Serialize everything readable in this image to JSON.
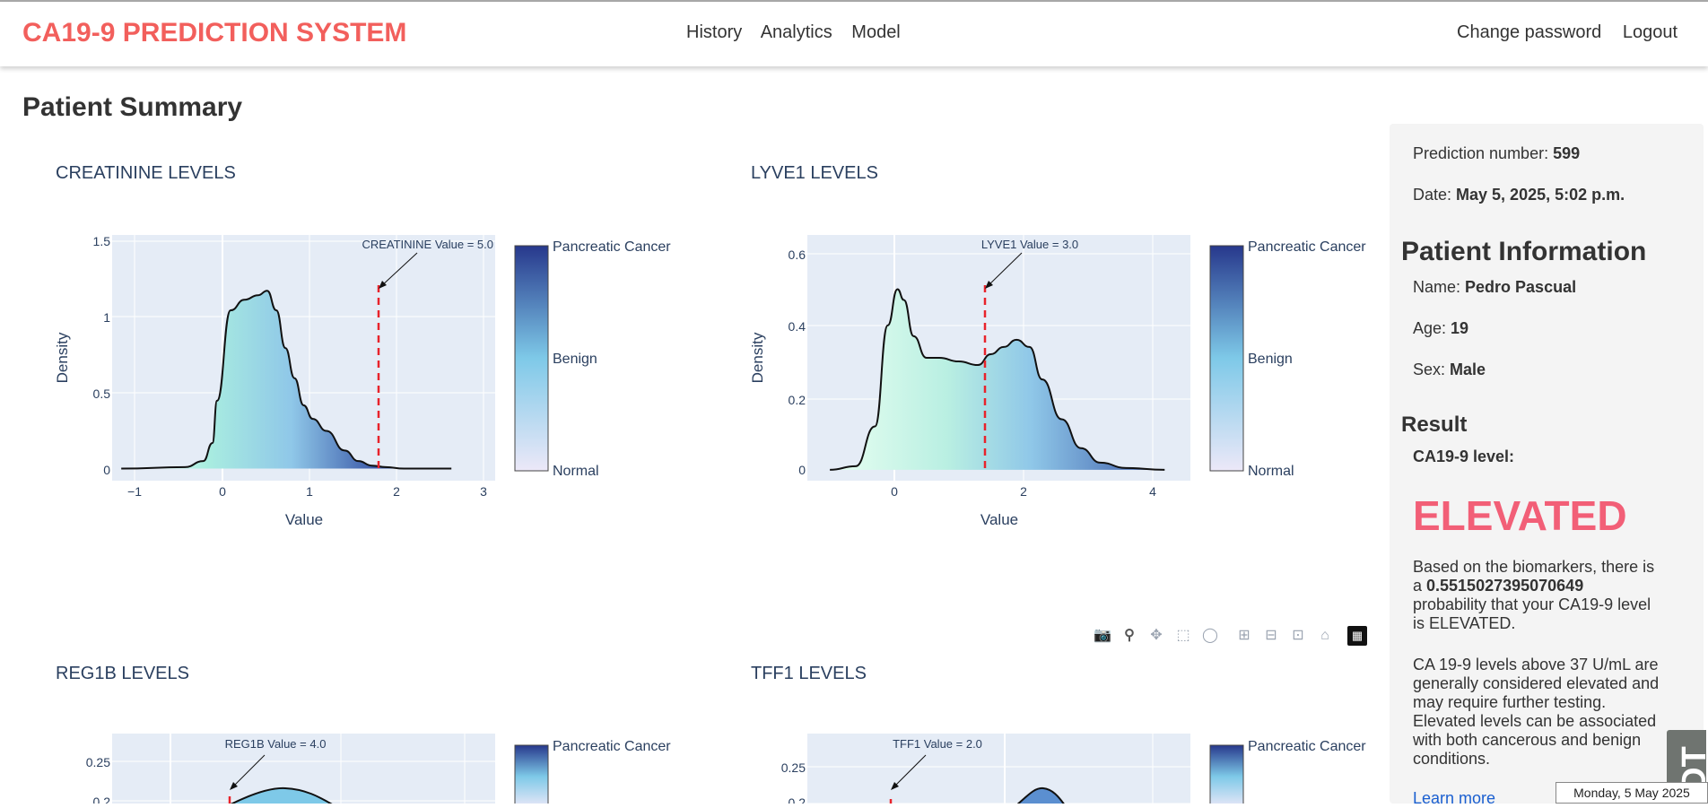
{
  "navbar": {
    "brand": "CA19-9 PREDICTION SYSTEM",
    "links": [
      "History",
      "Analytics",
      "Model"
    ],
    "right_links": [
      "Change password",
      "Logout"
    ]
  },
  "page_title": "Patient Summary",
  "plots": [
    {
      "title": "CREATININE LEVELS",
      "annotation": "CREATININE Value = 5.0",
      "ylabel": "Density",
      "xlabel": "Value",
      "xticks": [
        "−1",
        "0",
        "1",
        "2",
        "3"
      ],
      "yticks": [
        "0",
        "0.5",
        "1",
        "1.5"
      ]
    },
    {
      "title": "LYVE1 LEVELS",
      "annotation": "LYVE1 Value = 3.0",
      "ylabel": "Density",
      "xlabel": "Value",
      "xticks": [
        "0",
        "2",
        "4"
      ],
      "yticks": [
        "0",
        "0.2",
        "0.4",
        "0.6"
      ]
    },
    {
      "title": "REG1B LEVELS",
      "annotation": "REG1B Value = 4.0",
      "yticks": [
        "0.25",
        "0.2"
      ]
    },
    {
      "title": "TFF1 LEVELS",
      "annotation": "TFF1 Value = 2.0",
      "yticks": [
        "0.25",
        "0.2"
      ]
    }
  ],
  "colorbar": {
    "top": "Pancreatic Cancer",
    "mid": "Benign",
    "bottom": "Normal"
  },
  "chart_data": [
    {
      "type": "area",
      "title": "CREATININE LEVELS",
      "xlabel": "Value",
      "ylabel": "Density",
      "xlim": [
        -1.1,
        3.1
      ],
      "ylim": [
        -0.08,
        1.55
      ],
      "x": [
        -1.0,
        -0.3,
        -0.1,
        0.0,
        0.05,
        0.2,
        0.35,
        0.5,
        0.6,
        0.7,
        0.8,
        0.9,
        1.0,
        1.1,
        1.25,
        1.45,
        1.6,
        1.75,
        1.9,
        2.1,
        2.3,
        2.62
      ],
      "y": [
        0,
        0.01,
        0.05,
        0.17,
        0.45,
        1.05,
        1.12,
        1.15,
        1.18,
        1.05,
        0.8,
        0.6,
        0.42,
        0.33,
        0.25,
        0.12,
        0.05,
        0.02,
        0.01,
        0,
        0,
        0
      ],
      "marker": {
        "x": 1.8,
        "label": "CREATININE Value = 5.0"
      }
    },
    {
      "type": "area",
      "title": "LYVE1 LEVELS",
      "xlabel": "Value",
      "ylabel": "Density",
      "xlim": [
        -1.35,
        4.6
      ],
      "ylim": [
        -0.03,
        0.65
      ],
      "x": [
        -1.0,
        -0.6,
        -0.3,
        -0.1,
        0.05,
        0.15,
        0.3,
        0.5,
        0.7,
        1.0,
        1.3,
        1.5,
        1.7,
        1.9,
        2.1,
        2.3,
        2.6,
        2.9,
        3.2,
        3.6,
        4.2
      ],
      "y": [
        0,
        0.01,
        0.12,
        0.4,
        0.5,
        0.47,
        0.37,
        0.31,
        0.31,
        0.3,
        0.29,
        0.32,
        0.34,
        0.36,
        0.34,
        0.25,
        0.14,
        0.06,
        0.02,
        0.005,
        0
      ],
      "marker": {
        "x": 1.4,
        "label": "LYVE1 Value = 3.0"
      }
    },
    {
      "type": "area",
      "title": "REG1B LEVELS",
      "marker": {
        "label": "REG1B Value = 4.0"
      }
    },
    {
      "type": "area",
      "title": "TFF1 LEVELS",
      "marker": {
        "label": "TFF1 Value = 2.0"
      }
    }
  ],
  "sidebar": {
    "prediction_label": "Prediction number: ",
    "prediction_value": "599",
    "date_label": "Date: ",
    "date_value": "May 5, 2025, 5:02 p.m.",
    "patient_heading": "Patient Information",
    "name_label": "Name: ",
    "name_value": "Pedro Pascual",
    "age_label": "Age: ",
    "age_value": "19",
    "sex_label": "Sex: ",
    "sex_value": "Male",
    "result_heading": "Result",
    "ca_label": "CA19-9 level:",
    "status": "ELEVATED",
    "prob_pre": "Based on the biomarkers, there is a ",
    "prob_value": "0.5515027395070649",
    "prob_post": " probability that your CA19-9 level is ELEVATED.",
    "info": "CA 19-9 levels above 37 U/mL are generally considered elevated and may require further testing. Elevated levels can be associated with both cancerous and benign conditions.",
    "learn_more": "Learn more"
  },
  "date_tooltip": "Monday, 5 May 2025",
  "scroll_tab_text": "DT",
  "colors": {
    "brand": "#f25f5c",
    "elevated": "#f25f77",
    "plot_bg": "#e5ecf6",
    "marker": "#e8232b",
    "link": "#1a5fd0"
  }
}
